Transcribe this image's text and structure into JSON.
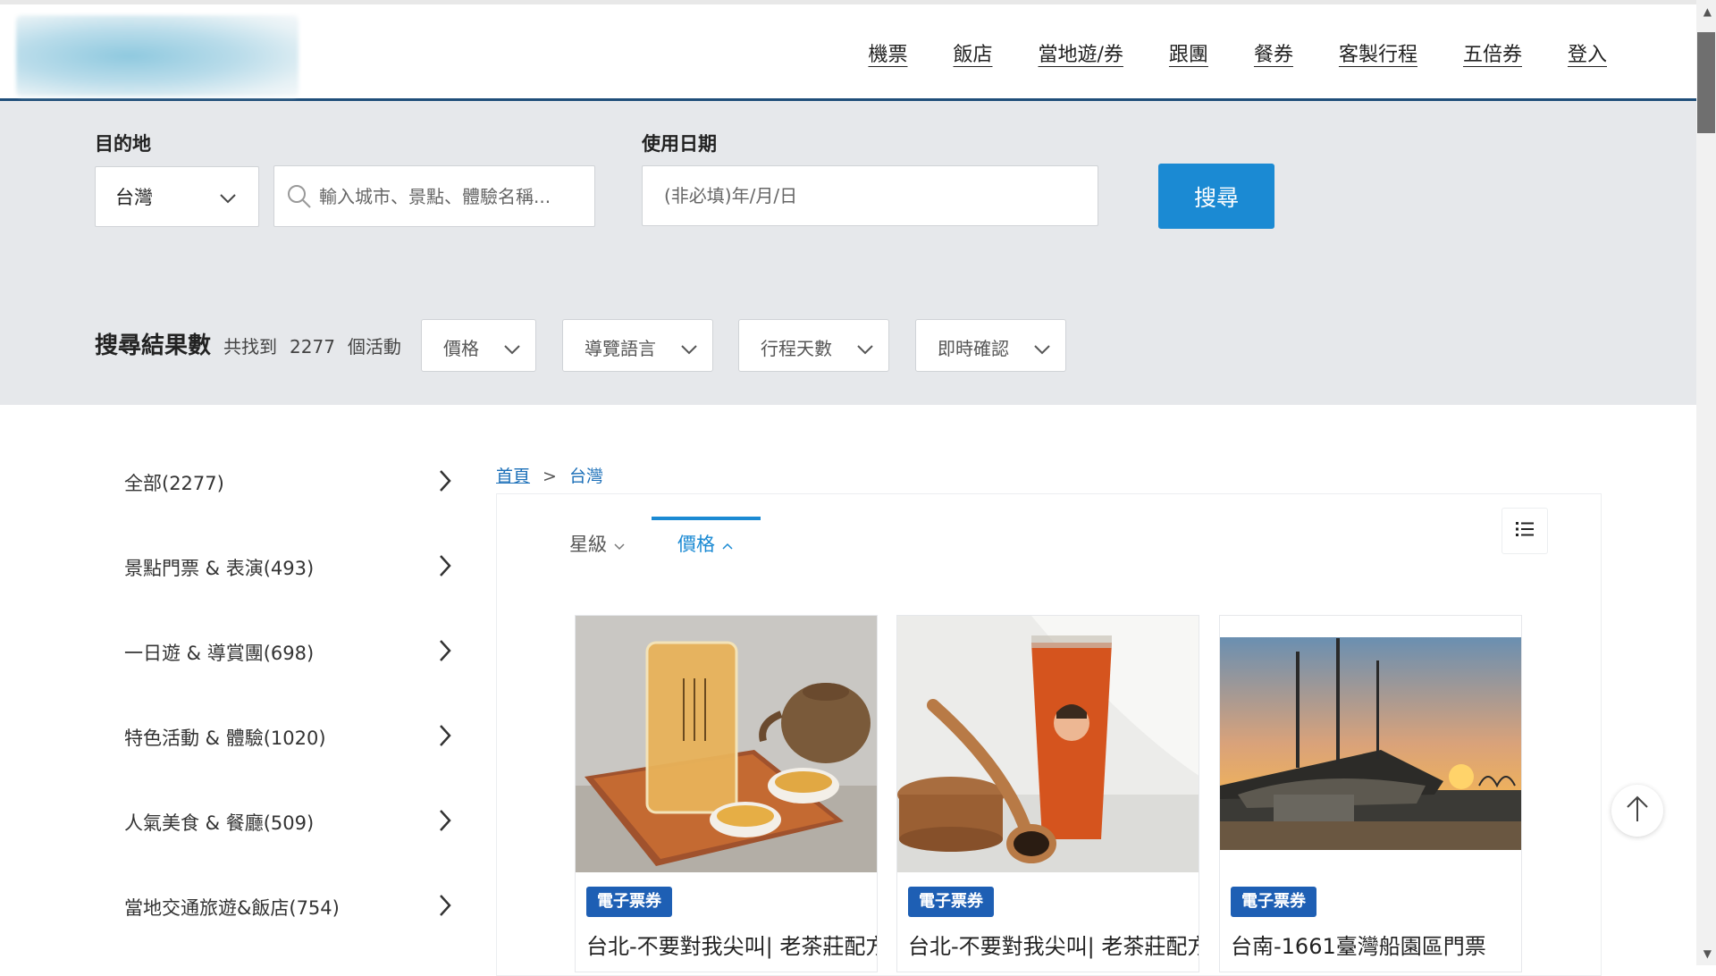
{
  "nav": {
    "items": [
      "機票",
      "飯店",
      "當地遊/券",
      "跟團",
      "餐券",
      "客製行程",
      "五倍券",
      "登入"
    ]
  },
  "search": {
    "destination_label": "目的地",
    "destination_value": "台灣",
    "keyword_placeholder": "輸入城市、景點、體驗名稱...",
    "date_label": "使用日期",
    "date_placeholder": "(非必填)年/月/日",
    "button_label": "搜尋"
  },
  "results": {
    "title": "搜尋結果數",
    "prefix": "共找到",
    "count": "2277",
    "suffix": "個活動"
  },
  "filters": [
    "價格",
    "導覽語言",
    "行程天數",
    "即時確認"
  ],
  "sidebar": {
    "items": [
      "全部(2277)",
      "景點門票 & 表演(493)",
      "一日遊 & 導賞團(698)",
      "特色活動 & 體驗(1020)",
      "人氣美食 & 餐廳(509)",
      "當地交通旅遊&飯店(754)"
    ]
  },
  "breadcrumb": {
    "home": "首頁",
    "separator": ">",
    "current": "台灣"
  },
  "sort": {
    "star_label": "星級",
    "price_label": "價格"
  },
  "cards": [
    {
      "badge": "電子票券",
      "title": "台北-不要對我尖叫| 老茶莊配方"
    },
    {
      "badge": "電子票券",
      "title": "台北-不要對我尖叫| 老茶莊配方"
    },
    {
      "badge": "電子票券",
      "title": "台南-1661臺灣船園區門票"
    }
  ],
  "colors": {
    "accent": "#1b8ad3",
    "badge": "#1e5fb4",
    "header_border": "#1f4e79",
    "panel_bg": "#e6e8eb"
  }
}
